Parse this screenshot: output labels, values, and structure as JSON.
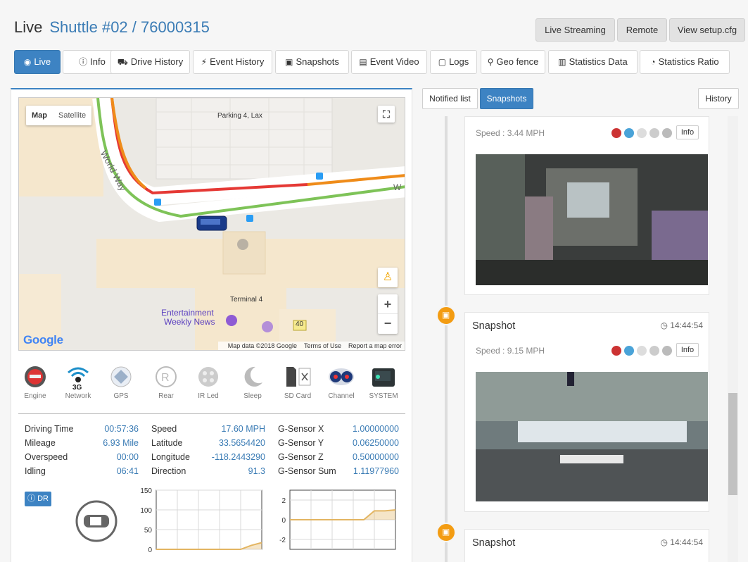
{
  "header": {
    "title": "Live",
    "vehicle": "Shuttle #02 / 76000315",
    "buttons": [
      "Live Streaming",
      "Remote",
      "View setup.cfg"
    ]
  },
  "tabs": [
    "Live",
    "Info",
    "Drive History",
    "Event History",
    "Snapshots",
    "Event Video",
    "Logs",
    "Geo fence",
    "Statistics Data",
    "Statistics Ratio"
  ],
  "map": {
    "type_buttons": [
      "Map",
      "Satellite"
    ],
    "labels": {
      "parking": "Parking 4, Lax",
      "terminal": "Terminal 4",
      "poi1": "Entertainment",
      "poi2": "Weekly News",
      "road": "World Way",
      "road_w": "W",
      "shield": "40"
    },
    "footer": [
      "Map data ©2018 Google",
      "Terms of Use",
      "Report a map error"
    ],
    "logo": "Google",
    "zoom_in": "+",
    "zoom_out": "−"
  },
  "status_icons": [
    {
      "label": "Engine",
      "icon": "engine-icon"
    },
    {
      "label": "Network",
      "icon": "network-icon",
      "badge": "3G"
    },
    {
      "label": "GPS",
      "icon": "gps-icon"
    },
    {
      "label": "Rear",
      "icon": "rear-icon"
    },
    {
      "label": "IR Led",
      "icon": "ir-led-icon"
    },
    {
      "label": "Sleep",
      "icon": "sleep-icon"
    },
    {
      "label": "SD Card",
      "icon": "sd-card-icon"
    },
    {
      "label": "Channel",
      "icon": "channel-icon"
    },
    {
      "label": "SYSTEM",
      "icon": "system-icon"
    }
  ],
  "stats": {
    "col1": [
      [
        "Driving Time",
        "00:57:36"
      ],
      [
        "Mileage",
        "6.93 Mile"
      ],
      [
        "Overspeed",
        "00:00"
      ],
      [
        "Idling",
        "06:41"
      ]
    ],
    "col2": [
      [
        "Speed",
        "17.60 MPH"
      ],
      [
        "Latitude",
        "33.5654420"
      ],
      [
        "Longitude",
        "-118.2443290"
      ],
      [
        "Direction",
        "91.3"
      ]
    ],
    "col3": [
      [
        "G-Sensor X",
        "1.00000000"
      ],
      [
        "G-Sensor Y",
        "0.06250000"
      ],
      [
        "G-Sensor Z",
        "0.50000000"
      ],
      [
        "G-Sensor Sum",
        "1.11977960"
      ]
    ]
  },
  "dr_label": "DR",
  "chart_data": [
    {
      "type": "area",
      "title": "",
      "xlabel": "",
      "ylabel": "",
      "ylim": [
        0,
        150
      ],
      "yticks": [
        "150",
        "100",
        "50",
        "0"
      ],
      "x": [
        0,
        1,
        2,
        3,
        4,
        5,
        6,
        7,
        8,
        9,
        10
      ],
      "values": [
        0,
        0,
        0,
        0,
        0,
        0,
        0,
        0,
        0,
        10,
        17
      ],
      "color": "#e3b562"
    },
    {
      "type": "area",
      "title": "",
      "xlabel": "",
      "ylabel": "",
      "ylim": [
        -3,
        3
      ],
      "yticks": [
        "2",
        "0",
        "-2"
      ],
      "x": [
        0,
        1,
        2,
        3,
        4,
        5,
        6,
        7,
        8,
        9,
        10
      ],
      "values": [
        0,
        0,
        0,
        0,
        0,
        0,
        0,
        0,
        0.9,
        0.9,
        1.0
      ],
      "color": "#e3b562"
    }
  ],
  "right": {
    "tabs": [
      "Notified list",
      "Snapshots"
    ],
    "history": "History",
    "cards": [
      {
        "title": "",
        "time": "",
        "speed": "Speed : 3.44 MPH",
        "info": "Info"
      },
      {
        "title": "Snapshot",
        "time": "14:44:54",
        "speed": "Speed : 9.15 MPH",
        "info": "Info"
      },
      {
        "title": "Snapshot",
        "time": "14:44:54",
        "speed": "",
        "info": ""
      }
    ]
  },
  "colors": {
    "accent": "#3d83c3",
    "timeline_dot": "#f39c12",
    "chart_fill": "#e3b562"
  }
}
